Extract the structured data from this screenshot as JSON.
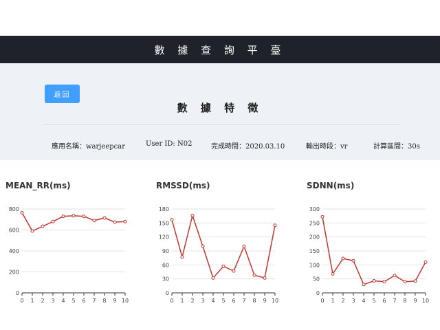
{
  "header": {
    "title": "數 據 查 詢 平 臺"
  },
  "toolbar": {
    "back_label": "返回"
  },
  "section": {
    "title": "數 據 特 徵"
  },
  "info": {
    "app_name": "應用名稱：warjeepcar",
    "user_id": "User ID: N02",
    "completed_time": "完成時間：2020.03.10",
    "output_period": "輸出時段：vr",
    "calc_interval": "計算區間：30s"
  },
  "colors": {
    "line": "#c23531",
    "accent": "#409eff",
    "navbar": "#1f2329"
  },
  "chart_data": [
    {
      "type": "line",
      "title": "MEAN_RR(ms)",
      "x": [
        0,
        1,
        2,
        3,
        4,
        5,
        6,
        7,
        8,
        9,
        10
      ],
      "values": [
        765,
        590,
        635,
        680,
        730,
        735,
        730,
        690,
        715,
        675,
        680
      ],
      "ylim": [
        0,
        800
      ],
      "yticks": [
        0,
        200,
        400,
        600,
        800
      ],
      "grid": true
    },
    {
      "type": "line",
      "title": "RMSSD(ms)",
      "x": [
        0,
        1,
        2,
        3,
        4,
        5,
        6,
        7,
        8,
        9,
        10
      ],
      "values": [
        157,
        77,
        166,
        100,
        32,
        57,
        47,
        100,
        38,
        32,
        145
      ],
      "ylim": [
        0,
        180
      ],
      "yticks": [
        0,
        30,
        60,
        90,
        120,
        150,
        180
      ],
      "grid": true
    },
    {
      "type": "line",
      "title": "SDNN(ms)",
      "x": [
        0,
        1,
        2,
        3,
        4,
        5,
        6,
        7,
        8,
        9,
        10
      ],
      "values": [
        272,
        68,
        123,
        115,
        30,
        43,
        40,
        62,
        40,
        42,
        110
      ],
      "ylim": [
        0,
        300
      ],
      "yticks": [
        0,
        50,
        100,
        150,
        200,
        250,
        300
      ],
      "grid": true
    }
  ]
}
